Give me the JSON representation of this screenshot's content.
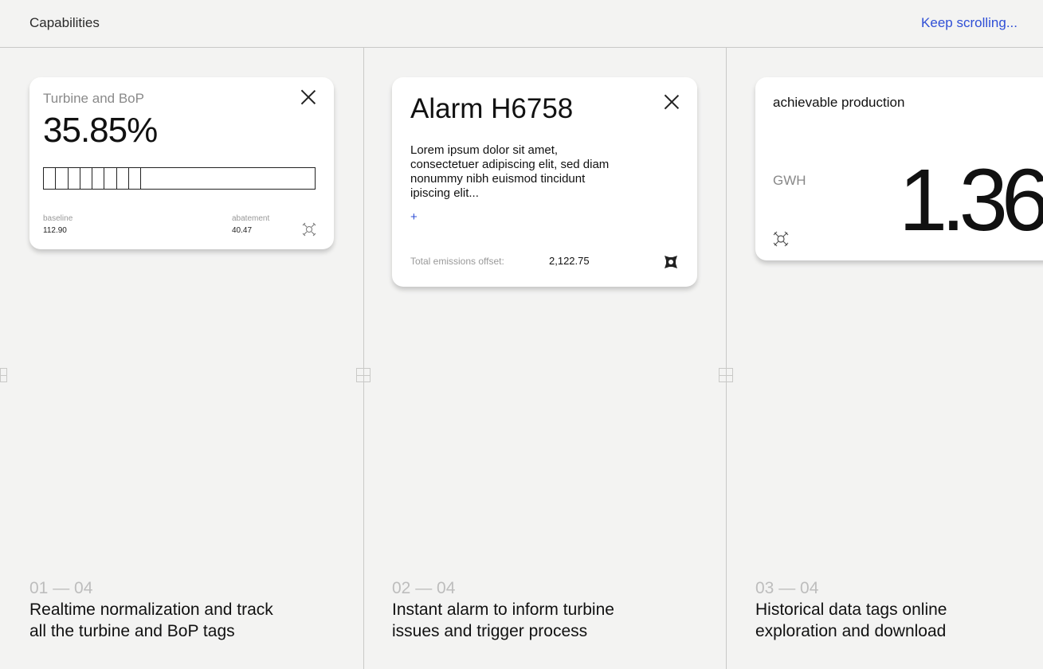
{
  "header": {
    "title": "Capabilities",
    "cta": "Keep scrolling..."
  },
  "cards": [
    {
      "label": "Turbine and BoP",
      "value": "35.85%",
      "progress_fraction": 0.3585,
      "baseline_label": "baseline",
      "baseline_value": "112.90",
      "abatement_label": "abatement",
      "abatement_value": "40.47"
    },
    {
      "title": "Alarm H6758",
      "body": "Lorem ipsum dolor sit amet, consectetuer adipiscing elit, sed diam nonummy nibh euismod tincidunt ipiscing elit...",
      "plus": "+",
      "footer_label": "Total emissions offset:",
      "footer_value": "2,122.75"
    },
    {
      "title": "achievable production",
      "unit": "GWH",
      "value": "1.36"
    }
  ],
  "steps": [
    {
      "counter": "01 — 04",
      "description": "Realtime normalization and track all the turbine and BoP tags"
    },
    {
      "counter": "02 — 04",
      "description": "Instant alarm to inform turbine issues and trigger process"
    },
    {
      "counter": "03 — 04",
      "description": "Historical data tags online exploration and download"
    }
  ],
  "colors": {
    "background": "#f3f3f2",
    "accent": "#2f4fd6",
    "divider": "#c9c9c7"
  }
}
